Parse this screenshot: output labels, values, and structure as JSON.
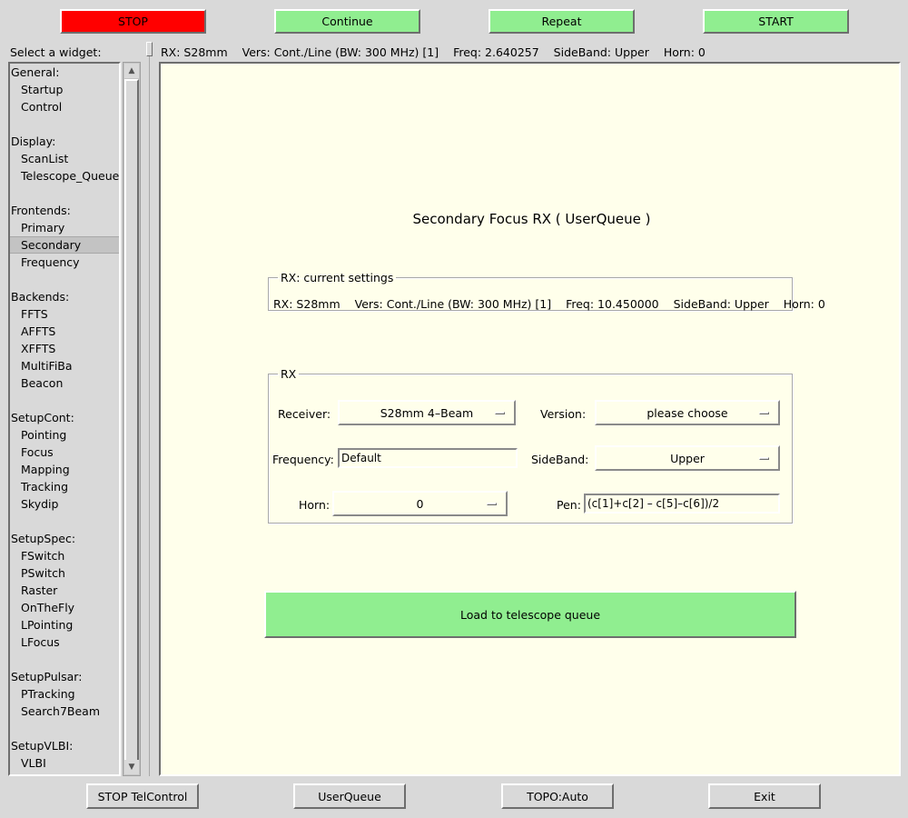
{
  "toolbar": {
    "stop": "STOP",
    "continue": "Continue",
    "repeat": "Repeat",
    "start": "START"
  },
  "sidebar": {
    "label": "Select a widget:",
    "groups": [
      {
        "header": "General:",
        "items": [
          "Startup",
          "Control"
        ]
      },
      {
        "header": "Display:",
        "items": [
          "ScanList",
          "Telescope_Queue"
        ]
      },
      {
        "header": "Frontends:",
        "items": [
          "Primary",
          "Secondary",
          "Frequency"
        ]
      },
      {
        "header": "Backends:",
        "items": [
          "FFTS",
          "AFFTS",
          "XFFTS",
          "MultiFiBa",
          "Beacon"
        ]
      },
      {
        "header": "SetupCont:",
        "items": [
          "Pointing",
          "Focus",
          "Mapping",
          "Tracking",
          "Skydip"
        ]
      },
      {
        "header": "SetupSpec:",
        "items": [
          "FSwitch",
          "PSwitch",
          "Raster",
          "OnTheFly",
          "LPointing",
          "LFocus"
        ]
      },
      {
        "header": "SetupPulsar:",
        "items": [
          "PTracking",
          "Search7Beam"
        ]
      },
      {
        "header": "SetupVLBI:",
        "items": [
          "VLBI"
        ]
      }
    ],
    "selected": "Secondary"
  },
  "status": {
    "rx": "RX: S28mm",
    "vers": "Vers: Cont./Line (BW: 300 MHz) [1]",
    "freq": "Freq: 2.640257",
    "sideband": "SideBand: Upper",
    "horn": "Horn: 0"
  },
  "main": {
    "title": "Secondary Focus RX ( UserQueue )",
    "current": {
      "legend": "RX: current settings",
      "rx": "RX: S28mm",
      "vers": "Vers: Cont./Line (BW: 300 MHz) [1]",
      "freq": "Freq: 10.450000",
      "sideband": "SideBand: Upper",
      "horn": "Horn: 0"
    },
    "rx": {
      "legend": "RX",
      "receiver_label": "Receiver:",
      "receiver_value": "S28mm 4–Beam",
      "version_label": "Version:",
      "version_value": "please choose",
      "frequency_label": "Frequency:",
      "frequency_value": "Default",
      "sideband_label": "SideBand:",
      "sideband_value": "Upper",
      "horn_label": "Horn:",
      "horn_value": "0",
      "pen_label": "Pen:",
      "pen_value": "(c[1]+c[2] – c[5]–c[6])/2"
    },
    "load_button": "Load to telescope queue"
  },
  "bottom": {
    "stop_telcontrol": "STOP TelControl",
    "userqueue": "UserQueue",
    "topo": "TOPO:Auto",
    "exit": "Exit"
  },
  "colors": {
    "stop": "#ff0000",
    "action": "#90ee90",
    "panel": "#ffffeb",
    "chrome": "#d9d9d9"
  }
}
